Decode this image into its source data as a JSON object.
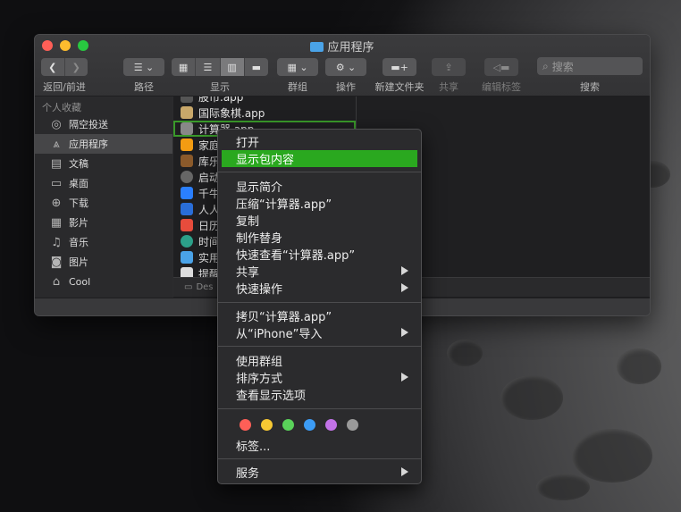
{
  "window": {
    "title": "应用程序",
    "toolbar": {
      "back_forward_label": "返回/前进",
      "path_label": "路径",
      "view_label": "显示",
      "group_label": "群组",
      "action_label": "操作",
      "new_folder_label": "新建文件夹",
      "share_label": "共享",
      "edit_tags_label": "编辑标签",
      "search_label": "搜索",
      "search_placeholder": "搜索"
    },
    "sidebar": {
      "heading": "个人收藏",
      "items": [
        {
          "label": "隔空投送",
          "icon": "airdrop-icon"
        },
        {
          "label": "应用程序",
          "icon": "applications-icon",
          "selected": true
        },
        {
          "label": "文稿",
          "icon": "documents-icon"
        },
        {
          "label": "桌面",
          "icon": "desktop-icon"
        },
        {
          "label": "下载",
          "icon": "downloads-icon"
        },
        {
          "label": "影片",
          "icon": "movies-icon"
        },
        {
          "label": "音乐",
          "icon": "music-icon"
        },
        {
          "label": "图片",
          "icon": "pictures-icon"
        },
        {
          "label": "Cool",
          "icon": "home-icon"
        }
      ]
    },
    "files": [
      {
        "name": "股市.app",
        "icon": "stocks-icon",
        "color": "#555"
      },
      {
        "name": "国际象棋.app",
        "icon": "chess-icon",
        "color": "#c9a86a"
      },
      {
        "name": "计算器.app",
        "icon": "calculator-icon",
        "color": "#888",
        "selected": true
      },
      {
        "name": "家庭",
        "icon": "home-app-icon",
        "color": "#f39c12"
      },
      {
        "name": "库乐",
        "icon": "library-icon",
        "color": "#8b5a2b"
      },
      {
        "name": "启动",
        "icon": "launchpad-icon",
        "color": "#666"
      },
      {
        "name": "千牛",
        "icon": "qianniu-icon",
        "color": "#2a7fff"
      },
      {
        "name": "人人",
        "icon": "renren-icon",
        "color": "#2a6ed8"
      },
      {
        "name": "日历",
        "icon": "calendar-icon",
        "color": "#e74c3c"
      },
      {
        "name": "时间",
        "icon": "time-machine-icon",
        "color": "#2ca089"
      },
      {
        "name": "实用",
        "icon": "utilities-folder-icon",
        "color": "#4aa3e8"
      },
      {
        "name": "提醒",
        "icon": "reminders-icon",
        "color": "#ddd"
      }
    ],
    "pathbar_text": "Des"
  },
  "context_menu": {
    "items": [
      {
        "label": "打开"
      },
      {
        "label": "显示包内容",
        "highlighted": true
      },
      {
        "label": "显示简介"
      },
      {
        "label": "压缩“计算器.app”"
      },
      {
        "label": "复制"
      },
      {
        "label": "制作替身"
      },
      {
        "label": "快速查看“计算器.app”"
      },
      {
        "label": "共享",
        "submenu": true
      },
      {
        "label": "快速操作",
        "submenu": true
      },
      {
        "label": "拷贝“计算器.app”"
      },
      {
        "label": "从“iPhone”导入",
        "submenu": true
      },
      {
        "label": "使用群组"
      },
      {
        "label": "排序方式",
        "submenu": true
      },
      {
        "label": "查看显示选项"
      },
      {
        "label": "标签..."
      },
      {
        "label": "服务",
        "submenu": true
      }
    ],
    "tag_colors": [
      "#fe5f57",
      "#f7c833",
      "#5ad25a",
      "#3c9cf5",
      "#c373e8",
      "#9a9a9a"
    ]
  }
}
